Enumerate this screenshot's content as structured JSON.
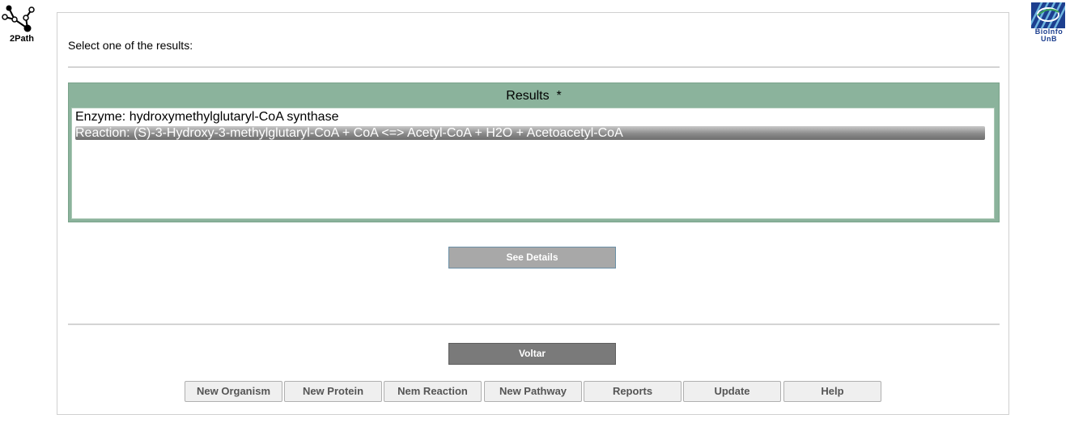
{
  "logos": {
    "left_text": "2Path",
    "right_text_line1": "BioInfo",
    "right_text_line2": "UnB"
  },
  "instruction": "Select one of the results:",
  "results": {
    "header": "Results  *",
    "items": [
      "Enzyme: hydroxymethylglutaryl-CoA synthase",
      "Reaction: (S)-3-Hydroxy-3-methylglutaryl-CoA + CoA <=> Acetyl-CoA + H2O + Acetoacetyl-CoA"
    ],
    "selected_index": 1
  },
  "buttons": {
    "see_details": "See Details",
    "voltar": "Voltar"
  },
  "nav": [
    "New Organism",
    "New Protein",
    "Nem Reaction",
    "New Pathway",
    "Reports",
    "Update",
    "Help"
  ],
  "colors": {
    "results_green": "#8bb39c",
    "selected_gray": "#8a8a8a",
    "brand_blue": "#1d3f8f"
  }
}
